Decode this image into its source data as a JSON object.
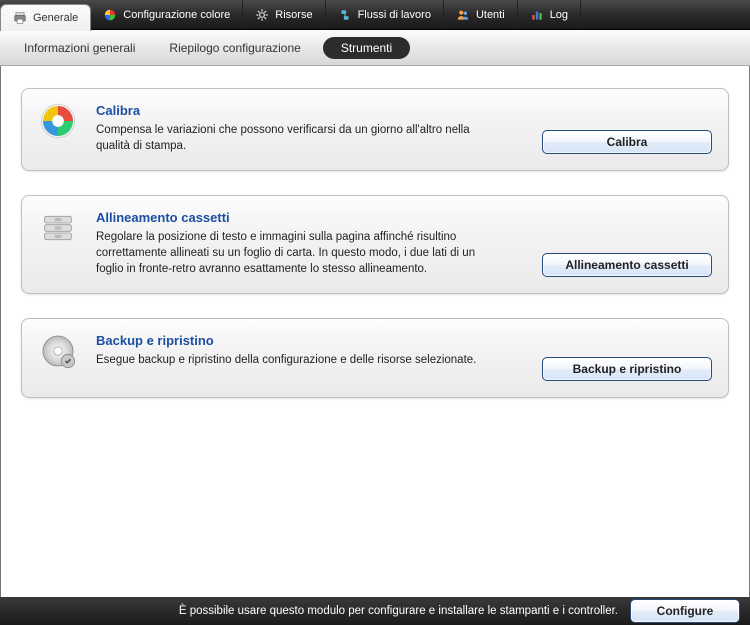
{
  "nav": {
    "tabs": [
      {
        "label": "Generale",
        "active": true
      },
      {
        "label": "Configurazione colore"
      },
      {
        "label": "Risorse"
      },
      {
        "label": "Flussi di lavoro"
      },
      {
        "label": "Utenti"
      },
      {
        "label": "Log"
      }
    ]
  },
  "subnav": {
    "items": [
      {
        "label": "Informazioni generali"
      },
      {
        "label": "Riepilogo configurazione"
      },
      {
        "label": "Strumenti",
        "active": true
      }
    ]
  },
  "panels": [
    {
      "title": "Calibra",
      "desc": "Compensa le variazioni che possono verificarsi da un giorno all'altro nella qualità di stampa.",
      "button": "Calibra",
      "icon": "color-wheel"
    },
    {
      "title": "Allineamento cassetti",
      "desc": "Regolare la posizione di testo e immagini sulla pagina affinché risultino correttamente allineati su un foglio di carta. In questo modo, i due lati di un foglio in fronte-retro avranno esattamente lo stesso allineamento.",
      "button": "Allineamento cassetti",
      "icon": "trays"
    },
    {
      "title": "Backup e ripristino",
      "desc": "Esegue backup e ripristino della configurazione e delle risorse selezionate.",
      "button": "Backup e ripristino",
      "icon": "disc"
    }
  ],
  "footer": {
    "text": "È possibile usare questo modulo per configurare e installare le stampanti e i controller.",
    "button": "Configure"
  }
}
